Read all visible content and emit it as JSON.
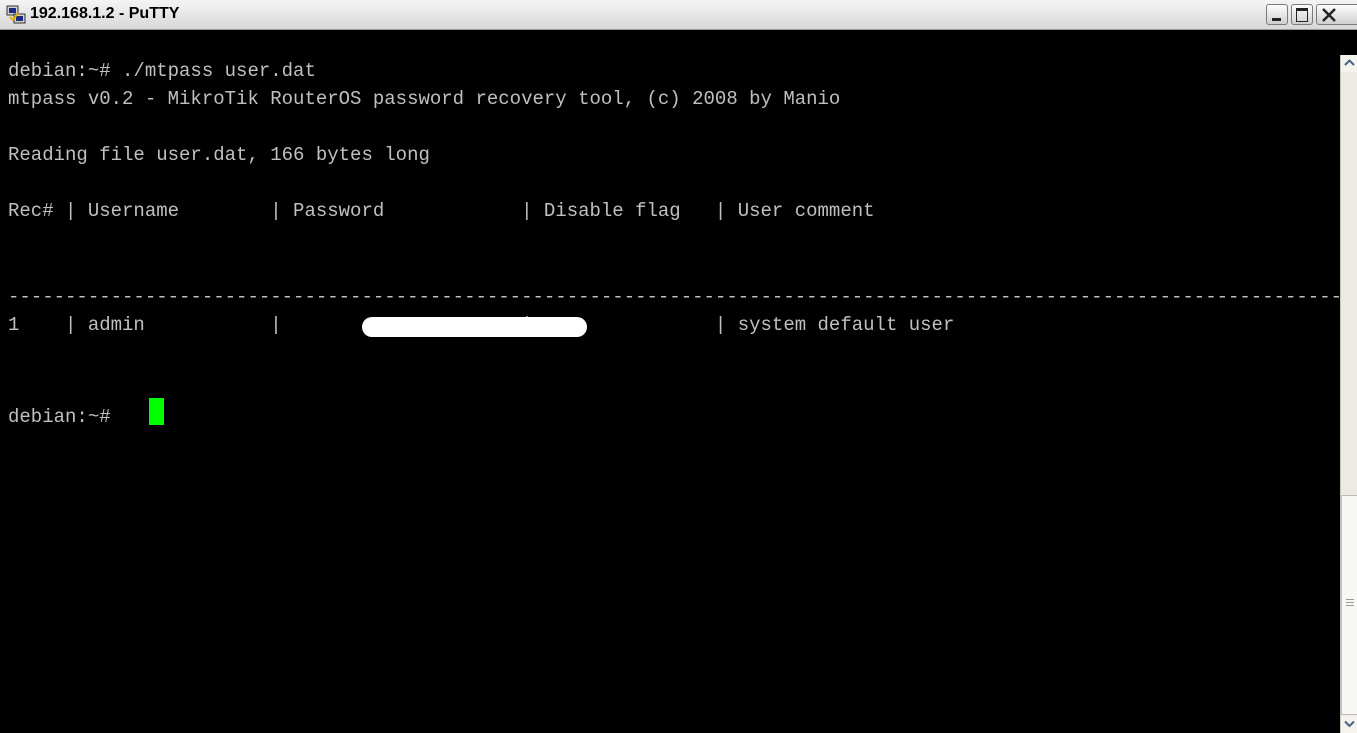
{
  "window": {
    "title": "192.168.1.2 - PuTTY",
    "icon": "putty-icon"
  },
  "terminal": {
    "lines": [
      "debian:~# ./mtpass user.dat",
      "mtpass v0.2 - MikroTik RouterOS password recovery tool, (c) 2008 by Manio",
      "Reading file user.dat, 166 bytes long",
      "Rec# | Username        | Password            | Disable flag   | User comment",
      "--------------------------------------------------------------------------------------------------------------------------",
      "1    | admin           |                     |                | system default user",
      "debian:~# "
    ],
    "masked_field": "password-redaction",
    "cursor_color": "#00ff00",
    "text_color": "#c0c0c0",
    "background": "#000000"
  },
  "controls": {
    "minimize": "minimize-icon",
    "maximize": "maximize-icon",
    "close": "close-icon"
  }
}
